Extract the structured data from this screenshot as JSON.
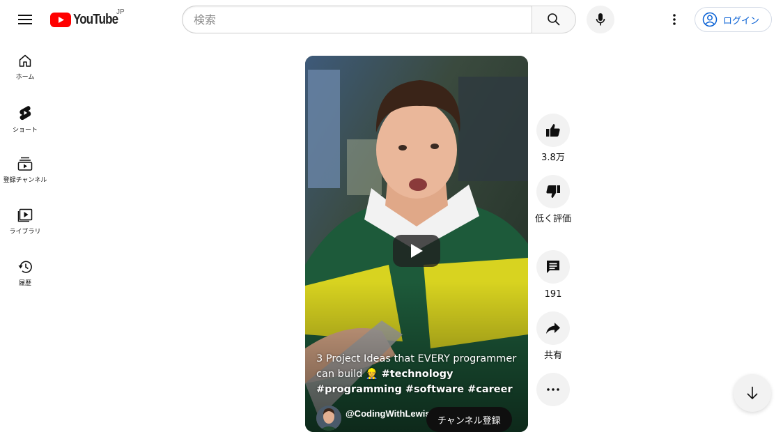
{
  "header": {
    "logo_text": "YouTube",
    "region": "JP",
    "search_placeholder": "検索",
    "login_label": "ログイン"
  },
  "sidebar": {
    "items": [
      {
        "label": "ホーム",
        "icon": "home-icon"
      },
      {
        "label": "ショート",
        "icon": "shorts-icon"
      },
      {
        "label": "登録チャンネル",
        "icon": "subscriptions-icon"
      },
      {
        "label": "ライブラリ",
        "icon": "library-icon"
      },
      {
        "label": "履歴",
        "icon": "history-icon"
      }
    ]
  },
  "video": {
    "title_plain": "3 Project Ideas that EVERY programmer can build 👷 ",
    "title_tags": "#technology #programming #software #career",
    "channel_name": "@CodingWithLewis",
    "subscribe_label": "チャンネル登録"
  },
  "actions": {
    "like_count": "3.8万",
    "dislike_label": "低く評価",
    "comment_count": "191",
    "share_label": "共有"
  },
  "colors": {
    "brand_red": "#ff0000",
    "link_blue": "#065fd4",
    "button_bg": "#f2f2f2"
  }
}
